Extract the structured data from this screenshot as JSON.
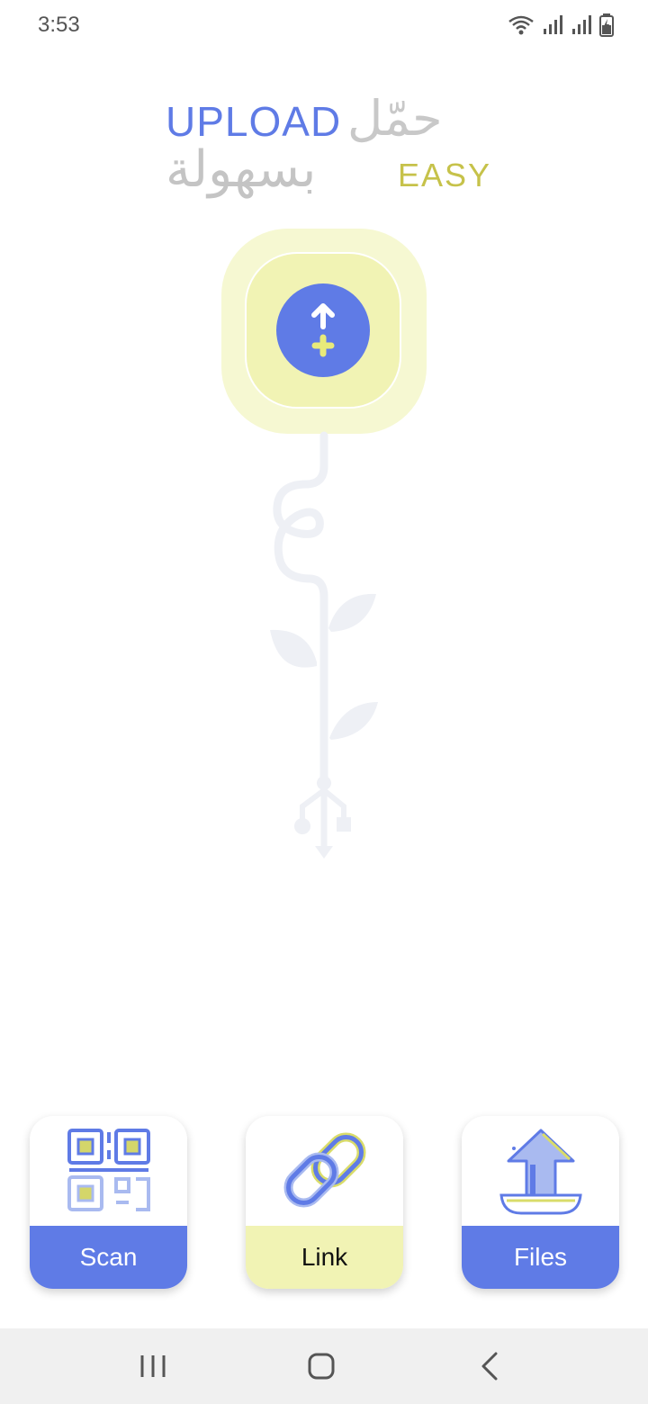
{
  "status_bar": {
    "time": "3:53",
    "icons": [
      "wifi-icon",
      "signal-icon",
      "signal-icon",
      "battery-charging-icon"
    ]
  },
  "logo": {
    "upload_text": "UPLOAD",
    "easy_text": "EASY",
    "arabic_top": "حمّل",
    "arabic_bottom": "بسهولة"
  },
  "upload_button": {
    "icon": "upload-plus-icon"
  },
  "actions": [
    {
      "label": "Scan",
      "icon": "qr-code-icon"
    },
    {
      "label": "Link",
      "icon": "link-chain-icon"
    },
    {
      "label": "Files",
      "icon": "upload-arrow-icon"
    }
  ],
  "navigation": {
    "icons": [
      "recent-apps-icon",
      "home-icon",
      "back-icon"
    ]
  },
  "colors": {
    "accent_blue": "#5f7be6",
    "accent_yellow": "#f1f3b4",
    "logo_yellow": "#c6c24a",
    "logo_gray": "#c4c4c4"
  }
}
